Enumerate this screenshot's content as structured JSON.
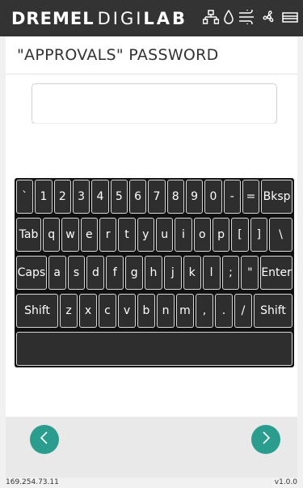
{
  "header": {
    "brand_dremel": "DREMEL",
    "brand_digi": "DIGI",
    "brand_lab": "LAB",
    "icons": [
      "network-icon",
      "droplet-icon",
      "airflow-icon",
      "fan-icon",
      "filament-icon"
    ]
  },
  "page": {
    "title": "\"APPROVALS\" PASSWORD",
    "password_value": ""
  },
  "keyboard": {
    "row1": [
      "`",
      "1",
      "2",
      "3",
      "4",
      "5",
      "6",
      "7",
      "8",
      "9",
      "0",
      "-",
      "=",
      "Bksp"
    ],
    "row2": [
      "Tab",
      "q",
      "w",
      "e",
      "r",
      "t",
      "y",
      "u",
      "i",
      "o",
      "p",
      "[",
      "]",
      "\\"
    ],
    "row3": [
      "Caps",
      "a",
      "s",
      "d",
      "f",
      "g",
      "h",
      "j",
      "k",
      "l",
      ";",
      "\"",
      "Enter"
    ],
    "row4": [
      "Shift",
      "z",
      "x",
      "c",
      "v",
      "b",
      "n",
      "m",
      ",",
      ".",
      "/",
      "Shift"
    ],
    "space": ""
  },
  "nav": {
    "back_icon": "chevron-left-icon",
    "next_icon": "chevron-right-icon",
    "accent": "#2a9d8f"
  },
  "status": {
    "ip": "169.254.73.11",
    "version": "v1.0.0"
  }
}
